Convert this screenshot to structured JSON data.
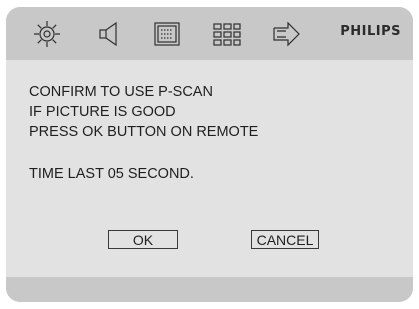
{
  "header": {
    "icons": [
      "gear-icon",
      "speaker-icon",
      "display-icon",
      "grid-icon",
      "arrow-right-icon"
    ],
    "brand": "PHILIPS"
  },
  "dialog": {
    "line1": "CONFIRM TO USE P-SCAN",
    "line2": "IF PICTURE IS GOOD",
    "line3": "PRESS OK BUTTON ON REMOTE",
    "timer": "TIME LAST 05 SECOND."
  },
  "buttons": {
    "ok": "OK",
    "cancel": "CANCEL"
  },
  "colors": {
    "bar": "#c8c8c8",
    "panel": "#e2e2e2",
    "text": "#1f1f1f"
  }
}
